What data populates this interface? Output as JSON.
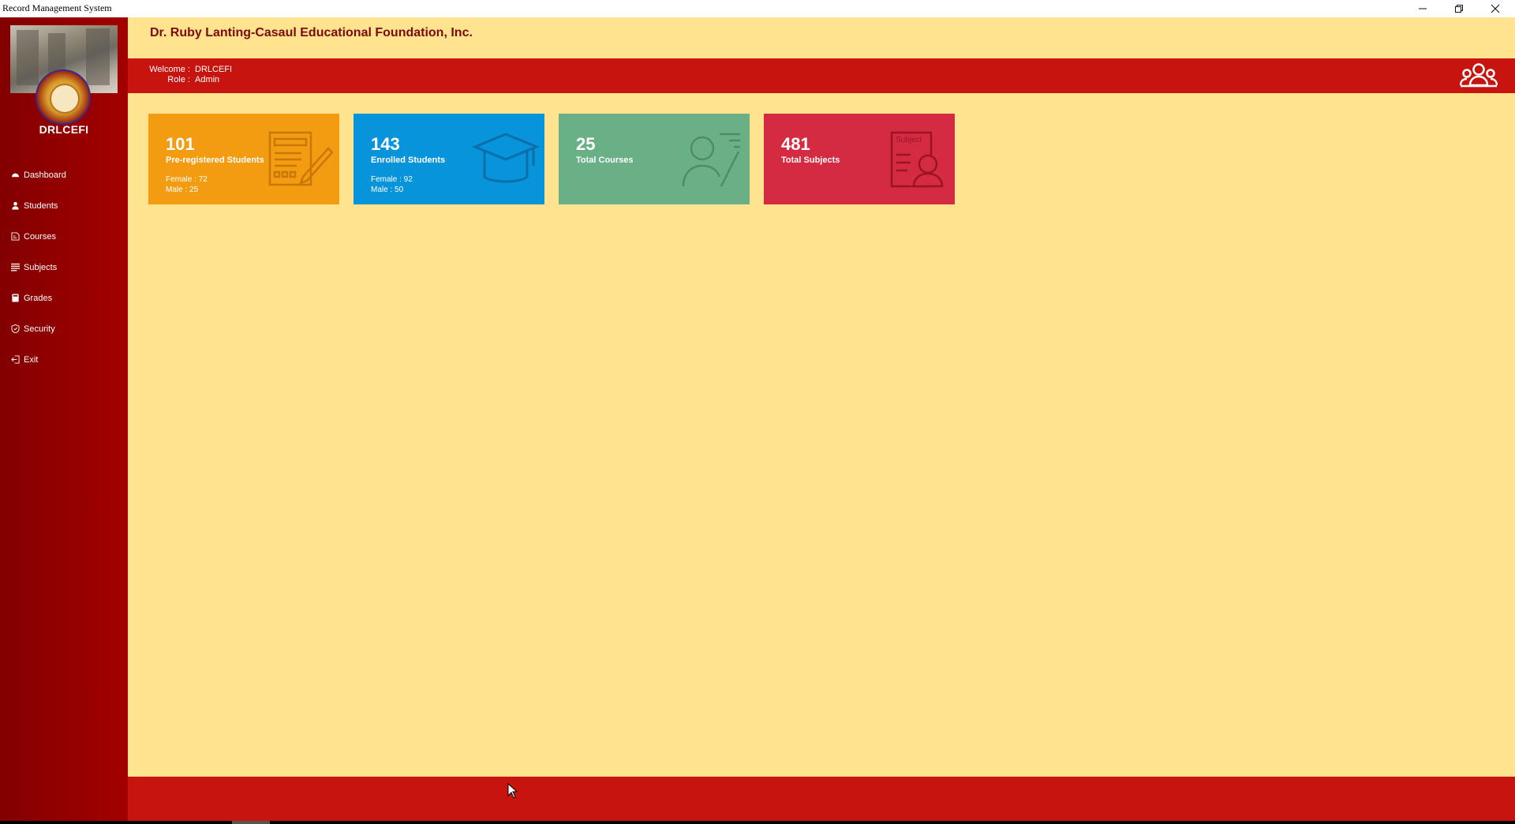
{
  "window": {
    "title": "Record Management System",
    "controls": [
      "minimize-icon",
      "restore-icon",
      "close-icon"
    ]
  },
  "sidebar": {
    "brand": "DRLCEFI",
    "items": [
      {
        "label": "Dashboard",
        "icon": "dashboard-icon"
      },
      {
        "label": "Students",
        "icon": "student-icon"
      },
      {
        "label": "Courses",
        "icon": "courses-icon"
      },
      {
        "label": "Subjects",
        "icon": "subjects-icon"
      },
      {
        "label": "Grades",
        "icon": "grades-icon"
      },
      {
        "label": "Security",
        "icon": "shield-icon"
      },
      {
        "label": "Exit",
        "icon": "exit-icon"
      }
    ]
  },
  "header": {
    "org_name": "Dr. Ruby Lanting-Casaul Educational Foundation, Inc.",
    "welcome_label": "Welcome :",
    "welcome_value": "DRLCEFI",
    "role_label": "Role :",
    "role_value": "Admin"
  },
  "cards": [
    {
      "value": "101",
      "label": "Pre-registered Students",
      "female": "Female : 72",
      "male": "Male : 25",
      "color": "#f39c12",
      "icon": "registration-form-icon"
    },
    {
      "value": "143",
      "label": "Enrolled Students",
      "female": "Female : 92",
      "male": "Male : 50",
      "color": "#0894db",
      "icon": "graduation-cap-icon"
    },
    {
      "value": "25",
      "label": "Total Courses",
      "color": "#69b086",
      "icon": "teacher-icon"
    },
    {
      "value": "481",
      "label": "Total Subjects",
      "color": "#d42b43",
      "icon": "subject-document-icon",
      "icon_text": "Subject"
    }
  ],
  "colors": {
    "sidebar": "#8b0000",
    "header_bar": "#c8140f",
    "background": "#ffe38f",
    "org_name": "#7d0a0a"
  }
}
